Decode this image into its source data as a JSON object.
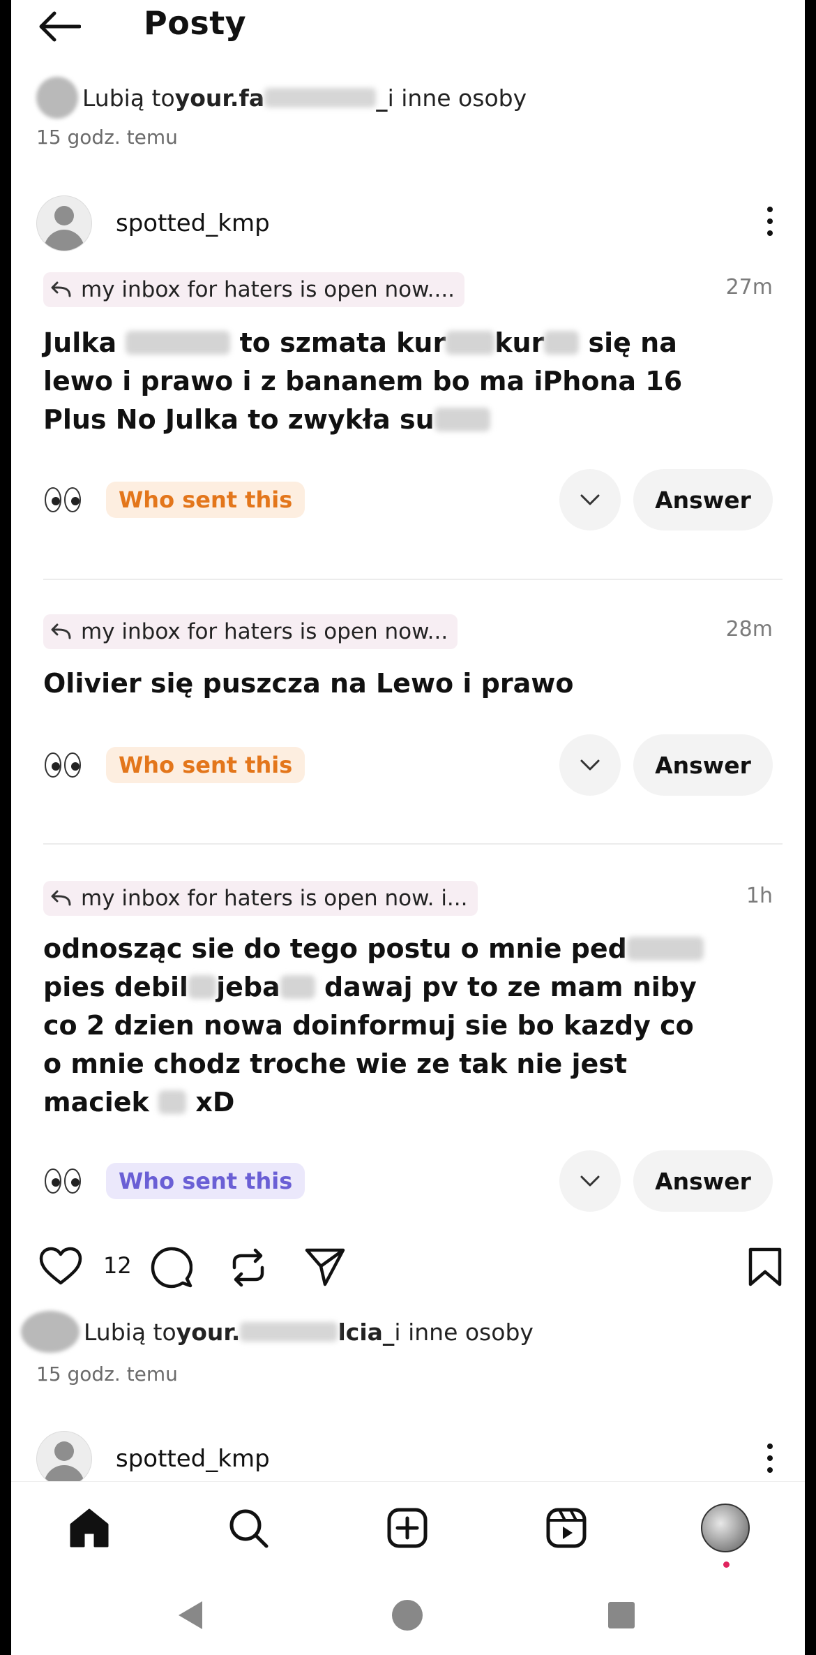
{
  "header": {
    "title": "Posty"
  },
  "liked_top": {
    "prefix": "Lubią to ",
    "user_start": "your.fa",
    "user_end": "_",
    "suffix": " i inne osoby",
    "time": "15 godz. temu"
  },
  "post": {
    "username": "spotted_kmp"
  },
  "messages": [
    {
      "reply": "my inbox for haters is open now....",
      "time": "27m",
      "lines": [
        "Julka",
        "to szmata kur",
        "kur",
        "się na",
        "lewo i prawo i z bananem bo ma iPhona 16",
        "Plus No Julka to zwykła su"
      ],
      "who": "Who sent this",
      "answer": "Answer"
    },
    {
      "reply": "my inbox for haters is open now...",
      "time": "28m",
      "text": "Olivier się puszcza na Lewo i prawo",
      "who": "Who sent this",
      "answer": "Answer"
    },
    {
      "reply": "my inbox for haters is open now. i...",
      "time": "1h",
      "lines": [
        "odnosząc sie do tego postu o mnie ped",
        "pies debil",
        "jeba",
        "dawaj pv to ze mam niby",
        "co 2 dzien nowa doinformuj sie bo kazdy co",
        "o mnie chodz troche wie ze tak nie jest",
        "maciek",
        "xD"
      ],
      "who": "Who sent this",
      "answer": "Answer"
    }
  ],
  "actions": {
    "like_count": "12"
  },
  "liked_bottom": {
    "prefix": "Lubią to ",
    "user_start": "your.",
    "user_end": "lcia_",
    "suffix": " i inne osoby",
    "time": "15 godz. temu"
  },
  "next_post": {
    "username": "spotted_kmp"
  },
  "colors": {
    "orange": "#e3761b",
    "purple": "#6a5fd5",
    "notification": "#e0245e"
  }
}
